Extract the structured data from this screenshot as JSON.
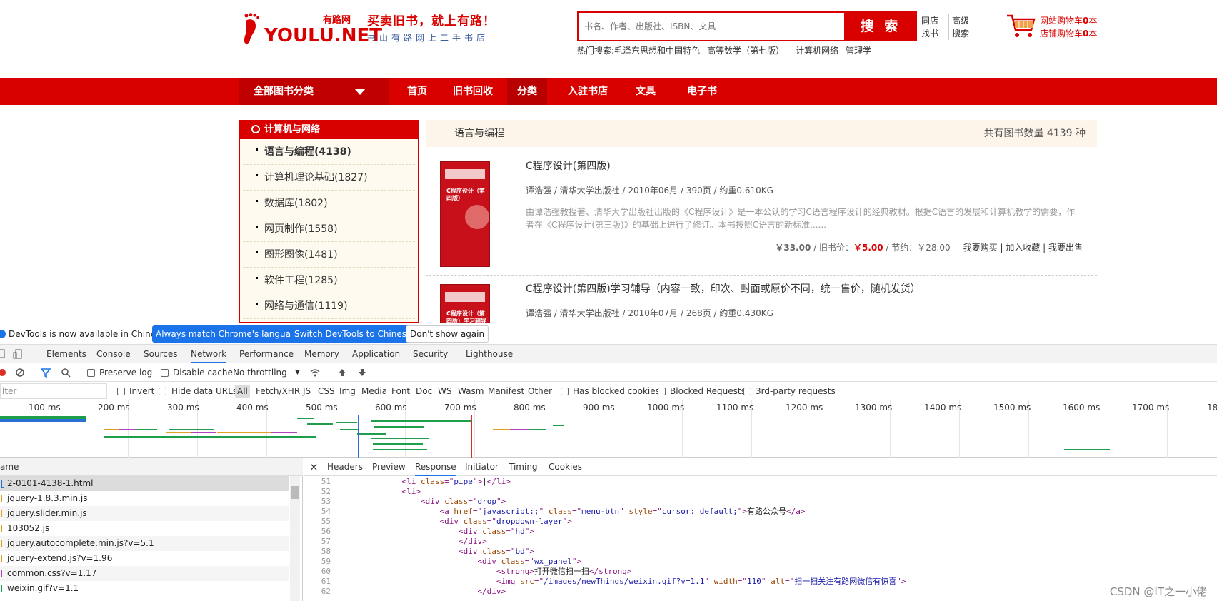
{
  "header": {
    "logo_text": "YOULU.NET",
    "logo_cn": "有路网",
    "slogan": "买卖旧书，就上有路！",
    "subslogan": "书山有路网上二手书店",
    "search_placeholder": "书名、作者、出版社、ISBN、文具",
    "search_button": "搜 索",
    "links": [
      "同店",
      "找书",
      "高级",
      "搜索"
    ],
    "hot_label": "热门搜索:",
    "hot_items": [
      "毛泽东思想和中国特色",
      "高等数学（第七版）",
      "计算机网络",
      "管理学"
    ],
    "cart_site_label": "网站购物车",
    "cart_shop_label": "店铺购物车",
    "cart_site_count": "0",
    "cart_shop_count": "0",
    "cart_unit": "本"
  },
  "nav": {
    "all_categories": "全部图书分类",
    "items": [
      "首页",
      "旧书回收",
      "分类",
      "入驻书店",
      "文具",
      "电子书"
    ]
  },
  "sidebar": {
    "title": "计算机与网络",
    "items": [
      "语言与编程(4138)",
      "计算机理论基础(1827)",
      "数据库(1802)",
      "网页制作(1558)",
      "图形图像(1481)",
      "软件工程(1285)",
      "网络与通信(1119)"
    ]
  },
  "listing": {
    "category": "语言与编程",
    "total_label": "共有图书数量 4139 种",
    "books": [
      {
        "title": "C程序设计(第四版)",
        "meta": "谭浩强 / 清华大学出版社 / 2010年06月 / 390页 / 约重0.610KG",
        "desc": "由谭浩强教授著、清华大学出版社出版的《C程序设计》是一本公认的学习C语言程序设计的经典教材。根据C语言的发展和计算机教学的需要，作者在《C程序设计(第三版)》的基础上进行了修订。本书按照C语言的新标准......",
        "orig_price": "￥33.00",
        "used_label": " / 旧书价：",
        "used_price": "￥5.00",
        "save": " / 节约：￥28.00",
        "actions": "我要购买 | 加入收藏 | 我要出售",
        "cover_text": "C程序设计（第四版）"
      },
      {
        "title": "C程序设计(第四版)学习辅导（内容一致，印次、封面或原价不同，统一售价，随机发货）",
        "meta": "谭浩强 / 清华大学出版社 / 2010年07月 / 268页 / 约重0.430KG",
        "cover_text": "C程序设计（第四版）学习辅导"
      }
    ]
  },
  "devtools": {
    "info_message": "DevTools is now available in Chinese!",
    "btn_match": "Always match Chrome's language",
    "btn_switch": "Switch DevTools to Chinese",
    "btn_dismiss": "Don't show again",
    "tabs": [
      "Elements",
      "Console",
      "Sources",
      "Network",
      "Performance",
      "Memory",
      "Application",
      "Security",
      "Lighthouse"
    ],
    "active_tab": "Network",
    "preserve_log": "Preserve log",
    "disable_cache": "Disable cache",
    "throttling": "No throttling",
    "filter_placeholder": "lter",
    "invert": "Invert",
    "hide_data_urls": "Hide data URLs",
    "types": [
      "All",
      "Fetch/XHR",
      "JS",
      "CSS",
      "Img",
      "Media",
      "Font",
      "Doc",
      "WS",
      "Wasm",
      "Manifest",
      "Other"
    ],
    "has_blocked": "Has blocked cookies",
    "blocked_requests": "Blocked Requests",
    "third_party": "3rd-party requests",
    "timeline_labels": [
      "100 ms",
      "200 ms",
      "300 ms",
      "400 ms",
      "500 ms",
      "600 ms",
      "700 ms",
      "800 ms",
      "900 ms",
      "1000 ms",
      "1100 ms",
      "1200 ms",
      "1300 ms",
      "1400 ms",
      "1500 ms",
      "1600 ms",
      "1700 ms",
      "180"
    ],
    "name_header": "ame",
    "requests": [
      "2-0101-4138-1.html",
      "jquery-1.8.3.min.js",
      "jquery.slider.min.js",
      "103052.js",
      "jquery.autocomplete.min.js?v=5.1",
      "jquery-extend.js?v=1.96",
      "common.css?v=1.17",
      "weixin.gif?v=1.1"
    ],
    "subtabs": [
      "Headers",
      "Preview",
      "Response",
      "Initiator",
      "Timing",
      "Cookies"
    ],
    "active_subtab": "Response",
    "code_lines": [
      {
        "n": "51",
        "indent": "            ",
        "parts": [
          [
            "tg",
            "<li "
          ],
          [
            "at",
            "class"
          ],
          [
            "tg",
            "=\""
          ],
          [
            "av",
            "pipe"
          ],
          [
            "tg",
            "\">"
          ],
          [
            "tx",
            "|"
          ],
          [
            "tg",
            "</li>"
          ]
        ]
      },
      {
        "n": "52",
        "indent": "            ",
        "parts": [
          [
            "tg",
            "<li>"
          ]
        ]
      },
      {
        "n": "53",
        "indent": "                ",
        "parts": [
          [
            "tg",
            "<div "
          ],
          [
            "at",
            "class"
          ],
          [
            "tg",
            "=\""
          ],
          [
            "av",
            "drop"
          ],
          [
            "tg",
            "\">"
          ]
        ]
      },
      {
        "n": "54",
        "indent": "                    ",
        "parts": [
          [
            "tg",
            "<a "
          ],
          [
            "at",
            "href"
          ],
          [
            "tg",
            "=\""
          ],
          [
            "av",
            "javascript:;"
          ],
          [
            "tg",
            "\" "
          ],
          [
            "at",
            "class"
          ],
          [
            "tg",
            "=\""
          ],
          [
            "av",
            "menu-btn"
          ],
          [
            "tg",
            "\" "
          ],
          [
            "at",
            "style"
          ],
          [
            "tg",
            "=\""
          ],
          [
            "av",
            "cursor: default;"
          ],
          [
            "tg",
            "\">"
          ],
          [
            "tx",
            "有路公众号"
          ],
          [
            "tg",
            "</a>"
          ]
        ]
      },
      {
        "n": "55",
        "indent": "                    ",
        "parts": [
          [
            "tg",
            "<div "
          ],
          [
            "at",
            "class"
          ],
          [
            "tg",
            "=\""
          ],
          [
            "av",
            "dropdown-layer"
          ],
          [
            "tg",
            "\">"
          ]
        ]
      },
      {
        "n": "56",
        "indent": "                        ",
        "parts": [
          [
            "tg",
            "<div "
          ],
          [
            "at",
            "class"
          ],
          [
            "tg",
            "=\""
          ],
          [
            "av",
            "hd"
          ],
          [
            "tg",
            "\">"
          ]
        ]
      },
      {
        "n": "57",
        "indent": "                        ",
        "parts": [
          [
            "tg",
            "</div>"
          ]
        ]
      },
      {
        "n": "58",
        "indent": "                        ",
        "parts": [
          [
            "tg",
            "<div "
          ],
          [
            "at",
            "class"
          ],
          [
            "tg",
            "=\""
          ],
          [
            "av",
            "bd"
          ],
          [
            "tg",
            "\">"
          ]
        ]
      },
      {
        "n": "59",
        "indent": "                            ",
        "parts": [
          [
            "tg",
            "<div "
          ],
          [
            "at",
            "class"
          ],
          [
            "tg",
            "=\""
          ],
          [
            "av",
            "wx_panel"
          ],
          [
            "tg",
            "\">"
          ]
        ]
      },
      {
        "n": "60",
        "indent": "                                ",
        "parts": [
          [
            "tg",
            "<strong>"
          ],
          [
            "tx",
            "打开微信扫一扫"
          ],
          [
            "tg",
            "</strong>"
          ]
        ]
      },
      {
        "n": "61",
        "indent": "                                ",
        "parts": [
          [
            "tg",
            "<img "
          ],
          [
            "at",
            "src"
          ],
          [
            "tg",
            "=\""
          ],
          [
            "av",
            "/images/newThings/weixin.gif?v=1.1"
          ],
          [
            "tg",
            "\" "
          ],
          [
            "at",
            "width"
          ],
          [
            "tg",
            "=\""
          ],
          [
            "av",
            "110"
          ],
          [
            "tg",
            "\" "
          ],
          [
            "at",
            "alt"
          ],
          [
            "tg",
            "=\""
          ],
          [
            "av",
            "扫一扫关注有路网微信有惊喜"
          ],
          [
            "tg",
            "\">"
          ]
        ]
      },
      {
        "n": "62",
        "indent": "                            ",
        "parts": [
          [
            "tg",
            "</div>"
          ]
        ]
      }
    ],
    "watermark": "CSDN @IT之一小佬"
  },
  "colors": {
    "brand_red": "#d90000",
    "devtools_blue": "#1a73e8"
  }
}
